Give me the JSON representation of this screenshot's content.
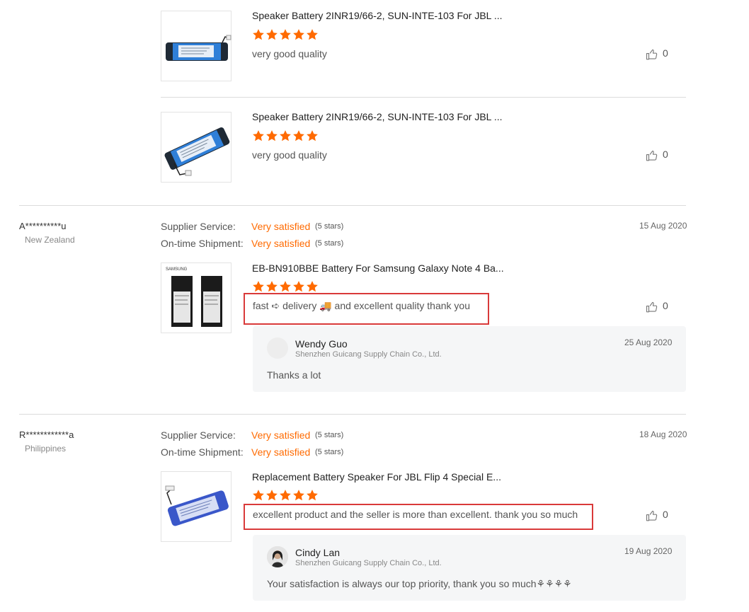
{
  "colors": {
    "accent": "#ff6a00",
    "highlight": "#d93a3a",
    "reply_bg": "#f5f6f7",
    "divider": "#dcdcdc"
  },
  "top_reviews": [
    {
      "product_title": "Speaker Battery 2INR19/66-2, SUN-INTE-103 For JBL ...",
      "rating": 5,
      "text": "very good quality",
      "likes": "0"
    },
    {
      "product_title": "Speaker Battery 2INR19/66-2, SUN-INTE-103 For JBL ...",
      "rating": 5,
      "text": "very good quality",
      "likes": "0"
    }
  ],
  "reviews": [
    {
      "user": "A**********u",
      "country": "New Zealand",
      "date": "15 Aug 2020",
      "supplier_service_label": "Supplier Service:",
      "supplier_service_value": "Very satisfied",
      "supplier_service_stars": "(5 stars)",
      "shipment_label": "On-time Shipment:",
      "shipment_value": "Very satisfied",
      "shipment_stars": "(5 stars)",
      "product_title": "EB-BN910BBE Battery For Samsung Galaxy Note 4 Ba...",
      "rating": 5,
      "text": "fast ➪ delivery 🚚 and excellent quality thank you",
      "likes": "0",
      "reply": {
        "name": "Wendy Guo",
        "company": "Shenzhen Guicang Supply Chain Co., Ltd.",
        "date": "25 Aug 2020",
        "text": "Thanks a lot"
      }
    },
    {
      "user": "R************a",
      "country": "Philippines",
      "date": "18 Aug 2020",
      "supplier_service_label": "Supplier Service:",
      "supplier_service_value": "Very satisfied",
      "supplier_service_stars": "(5 stars)",
      "shipment_label": "On-time Shipment:",
      "shipment_value": "Very satisfied",
      "shipment_stars": "(5 stars)",
      "product_title": "Replacement Battery Speaker For JBL Flip 4 Special E...",
      "rating": 5,
      "text": "excellent product and the seller is more than excellent. thank you so much",
      "likes": "0",
      "reply": {
        "name": "Cindy Lan",
        "company": "Shenzhen Guicang Supply Chain Co., Ltd.",
        "date": "19 Aug 2020",
        "text": "Your satisfaction is always our top priority, thank you so much⚘⚘⚘⚘"
      }
    }
  ]
}
